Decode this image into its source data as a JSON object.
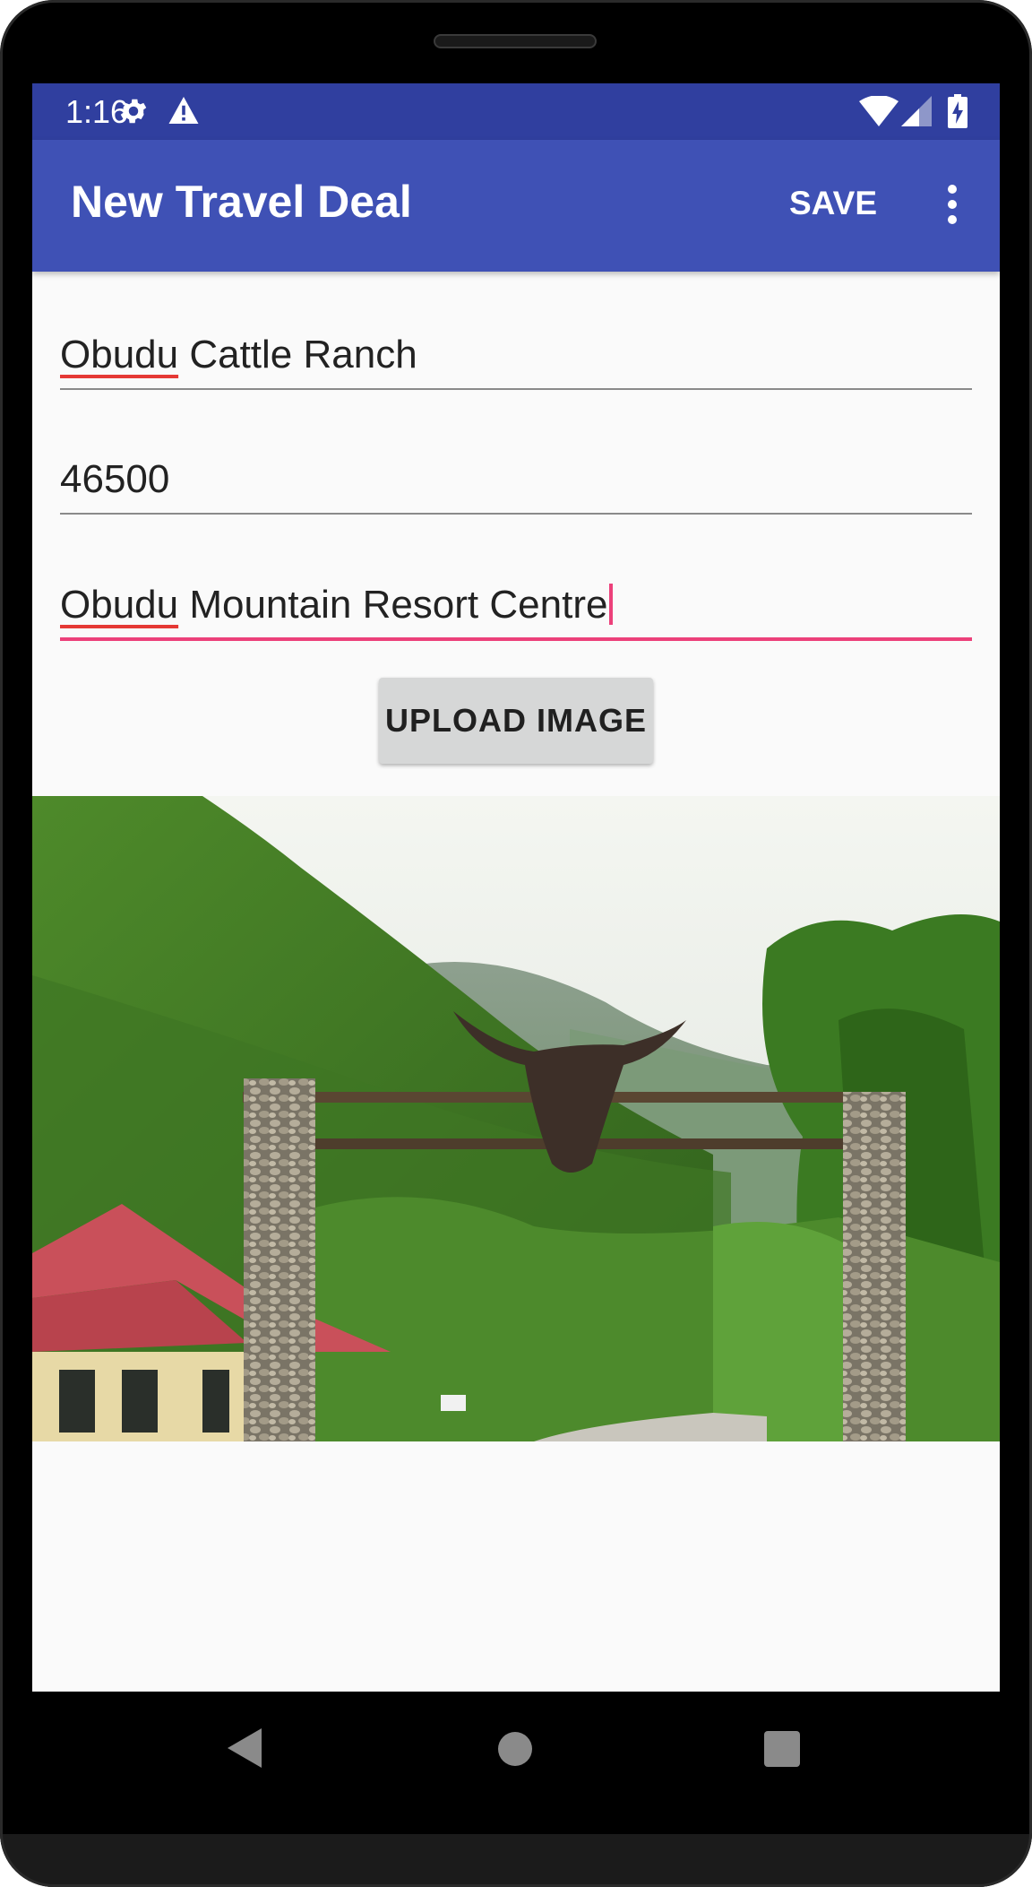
{
  "status_bar": {
    "time": "1:16",
    "icons": [
      "gear-icon",
      "warning-icon",
      "wifi-icon",
      "cell-signal-icon",
      "battery-charging-icon"
    ]
  },
  "app_bar": {
    "title": "New Travel Deal",
    "save_label": "SAVE",
    "overflow_icon": "more-vert-icon"
  },
  "form": {
    "title_field": {
      "prefix": "Obudu",
      "rest": " Cattle Ranch"
    },
    "price_field": {
      "value": "46500"
    },
    "description_field": {
      "prefix": "Obudu",
      "rest": " Mountain Resort Centre"
    },
    "upload_button_label": "UPLOAD IMAGE"
  },
  "deal_image": {
    "subject": "obudu-cattle-ranch-gate-photo"
  },
  "nav_bar": {
    "icons": [
      "back-icon",
      "home-icon",
      "recents-icon"
    ]
  },
  "colors": {
    "status_bar": "#303f9f",
    "app_bar": "#3f51b5",
    "accent": "#ec407a",
    "background": "#fafafa"
  }
}
